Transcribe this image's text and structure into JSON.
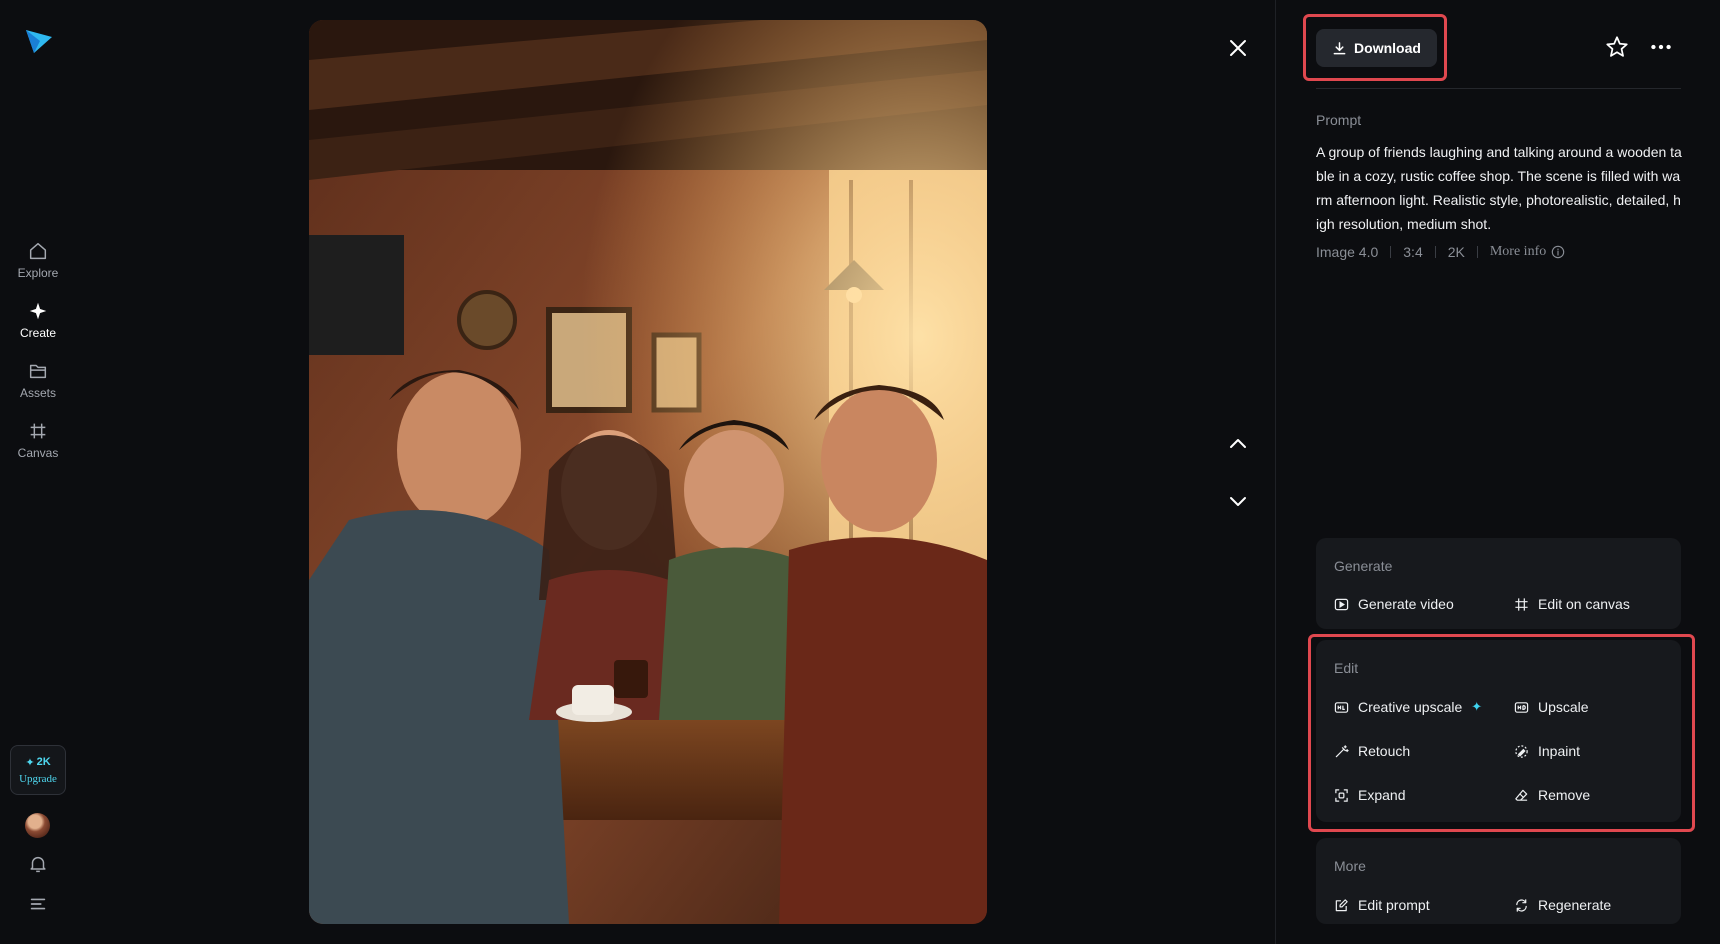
{
  "nav": {
    "items": [
      {
        "label": "Explore",
        "icon": "home-icon"
      },
      {
        "label": "Create",
        "icon": "sparkle-icon"
      },
      {
        "label": "Assets",
        "icon": "folder-icon"
      },
      {
        "label": "Canvas",
        "icon": "canvas-icon"
      }
    ],
    "credits": "2K",
    "upgrade_label": "Upgrade"
  },
  "toolbar": {
    "download_label": "Download"
  },
  "prompt": {
    "label": "Prompt",
    "text": "A group of friends laughing and talking around a wooden table in a cozy, rustic coffee shop. The scene is filled with warm afternoon light. Realistic style, photorealistic, detailed, high resolution, medium shot.",
    "model": "Image 4.0",
    "ratio": "3:4",
    "resolution": "2K",
    "more_info_label": "More info"
  },
  "generate": {
    "title": "Generate",
    "actions": [
      {
        "label": "Generate video",
        "icon": "play-icon"
      },
      {
        "label": "Edit on canvas",
        "icon": "canvas-icon"
      }
    ]
  },
  "edit": {
    "title": "Edit",
    "actions": [
      {
        "label": "Creative upscale",
        "icon": "hd-plus-icon"
      },
      {
        "label": "Upscale",
        "icon": "hd-icon"
      },
      {
        "label": "Retouch",
        "icon": "magic-wand-icon"
      },
      {
        "label": "Inpaint",
        "icon": "inpaint-icon"
      },
      {
        "label": "Expand",
        "icon": "expand-icon"
      },
      {
        "label": "Remove",
        "icon": "eraser-icon"
      }
    ]
  },
  "more": {
    "title": "More",
    "actions": [
      {
        "label": "Edit prompt",
        "icon": "edit-prompt-icon"
      },
      {
        "label": "Regenerate",
        "icon": "regenerate-icon"
      }
    ]
  },
  "colors": {
    "background": "#0c0d10",
    "card": "#17191d",
    "accent": "#3fd4f0",
    "highlight": "#e0484f"
  }
}
